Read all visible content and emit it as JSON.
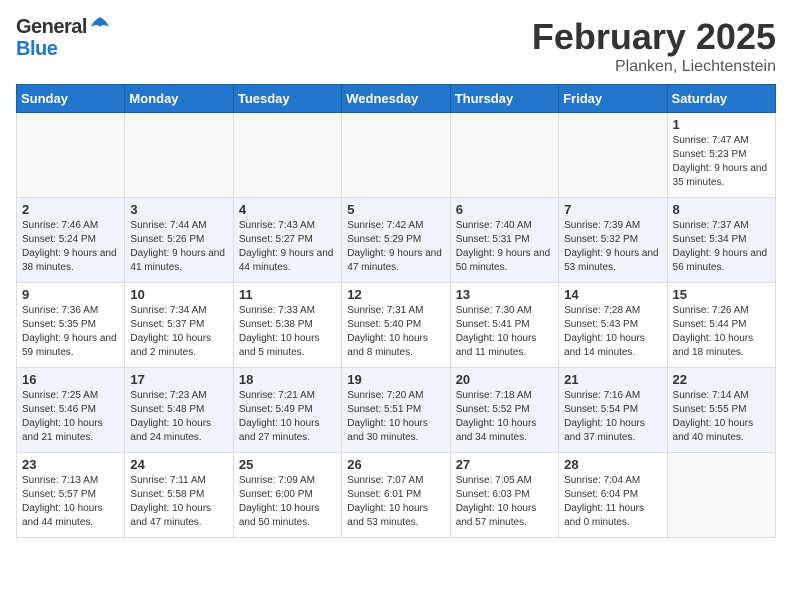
{
  "header": {
    "logo_general": "General",
    "logo_blue": "Blue",
    "month_year": "February 2025",
    "location": "Planken, Liechtenstein"
  },
  "weekdays": [
    "Sunday",
    "Monday",
    "Tuesday",
    "Wednesday",
    "Thursday",
    "Friday",
    "Saturday"
  ],
  "weeks": [
    {
      "alt": false,
      "days": [
        {
          "num": "",
          "info": ""
        },
        {
          "num": "",
          "info": ""
        },
        {
          "num": "",
          "info": ""
        },
        {
          "num": "",
          "info": ""
        },
        {
          "num": "",
          "info": ""
        },
        {
          "num": "",
          "info": ""
        },
        {
          "num": "1",
          "info": "Sunrise: 7:47 AM\nSunset: 5:23 PM\nDaylight: 9 hours and 35 minutes."
        }
      ]
    },
    {
      "alt": true,
      "days": [
        {
          "num": "2",
          "info": "Sunrise: 7:46 AM\nSunset: 5:24 PM\nDaylight: 9 hours and 38 minutes."
        },
        {
          "num": "3",
          "info": "Sunrise: 7:44 AM\nSunset: 5:26 PM\nDaylight: 9 hours and 41 minutes."
        },
        {
          "num": "4",
          "info": "Sunrise: 7:43 AM\nSunset: 5:27 PM\nDaylight: 9 hours and 44 minutes."
        },
        {
          "num": "5",
          "info": "Sunrise: 7:42 AM\nSunset: 5:29 PM\nDaylight: 9 hours and 47 minutes."
        },
        {
          "num": "6",
          "info": "Sunrise: 7:40 AM\nSunset: 5:31 PM\nDaylight: 9 hours and 50 minutes."
        },
        {
          "num": "7",
          "info": "Sunrise: 7:39 AM\nSunset: 5:32 PM\nDaylight: 9 hours and 53 minutes."
        },
        {
          "num": "8",
          "info": "Sunrise: 7:37 AM\nSunset: 5:34 PM\nDaylight: 9 hours and 56 minutes."
        }
      ]
    },
    {
      "alt": false,
      "days": [
        {
          "num": "9",
          "info": "Sunrise: 7:36 AM\nSunset: 5:35 PM\nDaylight: 9 hours and 59 minutes."
        },
        {
          "num": "10",
          "info": "Sunrise: 7:34 AM\nSunset: 5:37 PM\nDaylight: 10 hours and 2 minutes."
        },
        {
          "num": "11",
          "info": "Sunrise: 7:33 AM\nSunset: 5:38 PM\nDaylight: 10 hours and 5 minutes."
        },
        {
          "num": "12",
          "info": "Sunrise: 7:31 AM\nSunset: 5:40 PM\nDaylight: 10 hours and 8 minutes."
        },
        {
          "num": "13",
          "info": "Sunrise: 7:30 AM\nSunset: 5:41 PM\nDaylight: 10 hours and 11 minutes."
        },
        {
          "num": "14",
          "info": "Sunrise: 7:28 AM\nSunset: 5:43 PM\nDaylight: 10 hours and 14 minutes."
        },
        {
          "num": "15",
          "info": "Sunrise: 7:26 AM\nSunset: 5:44 PM\nDaylight: 10 hours and 18 minutes."
        }
      ]
    },
    {
      "alt": true,
      "days": [
        {
          "num": "16",
          "info": "Sunrise: 7:25 AM\nSunset: 5:46 PM\nDaylight: 10 hours and 21 minutes."
        },
        {
          "num": "17",
          "info": "Sunrise: 7:23 AM\nSunset: 5:48 PM\nDaylight: 10 hours and 24 minutes."
        },
        {
          "num": "18",
          "info": "Sunrise: 7:21 AM\nSunset: 5:49 PM\nDaylight: 10 hours and 27 minutes."
        },
        {
          "num": "19",
          "info": "Sunrise: 7:20 AM\nSunset: 5:51 PM\nDaylight: 10 hours and 30 minutes."
        },
        {
          "num": "20",
          "info": "Sunrise: 7:18 AM\nSunset: 5:52 PM\nDaylight: 10 hours and 34 minutes."
        },
        {
          "num": "21",
          "info": "Sunrise: 7:16 AM\nSunset: 5:54 PM\nDaylight: 10 hours and 37 minutes."
        },
        {
          "num": "22",
          "info": "Sunrise: 7:14 AM\nSunset: 5:55 PM\nDaylight: 10 hours and 40 minutes."
        }
      ]
    },
    {
      "alt": false,
      "days": [
        {
          "num": "23",
          "info": "Sunrise: 7:13 AM\nSunset: 5:57 PM\nDaylight: 10 hours and 44 minutes."
        },
        {
          "num": "24",
          "info": "Sunrise: 7:11 AM\nSunset: 5:58 PM\nDaylight: 10 hours and 47 minutes."
        },
        {
          "num": "25",
          "info": "Sunrise: 7:09 AM\nSunset: 6:00 PM\nDaylight: 10 hours and 50 minutes."
        },
        {
          "num": "26",
          "info": "Sunrise: 7:07 AM\nSunset: 6:01 PM\nDaylight: 10 hours and 53 minutes."
        },
        {
          "num": "27",
          "info": "Sunrise: 7:05 AM\nSunset: 6:03 PM\nDaylight: 10 hours and 57 minutes."
        },
        {
          "num": "28",
          "info": "Sunrise: 7:04 AM\nSunset: 6:04 PM\nDaylight: 11 hours and 0 minutes."
        },
        {
          "num": "",
          "info": ""
        }
      ]
    }
  ]
}
